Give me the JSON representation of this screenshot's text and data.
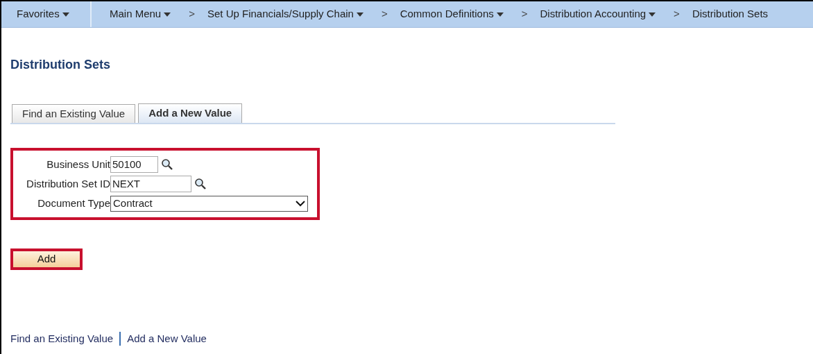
{
  "nav": [
    {
      "label": "Favorites",
      "dropdown": true
    },
    {
      "label": "Main Menu",
      "dropdown": true
    },
    {
      "label": "Set Up Financials/Supply Chain",
      "dropdown": true,
      "separator": ">"
    },
    {
      "label": "Common Definitions",
      "dropdown": true,
      "separator": ">"
    },
    {
      "label": "Distribution Accounting",
      "dropdown": true,
      "separator": ">"
    },
    {
      "label": "Distribution Sets",
      "dropdown": false,
      "separator": ">"
    }
  ],
  "page_title": "Distribution Sets",
  "tabs": [
    {
      "label": "Find an Existing Value",
      "selected": false
    },
    {
      "label": "Add a New Value",
      "selected": true
    }
  ],
  "fields": [
    {
      "kind": "lookup",
      "label": "Business Unit",
      "value": "50100"
    },
    {
      "kind": "lookup",
      "label": "Distribution Set ID",
      "value": "NEXT"
    },
    {
      "kind": "select",
      "label": "Document Type",
      "value": "Contract"
    }
  ],
  "add_button": "Add",
  "footer_links": [
    "Find an Existing Value",
    "Add a New Value"
  ]
}
